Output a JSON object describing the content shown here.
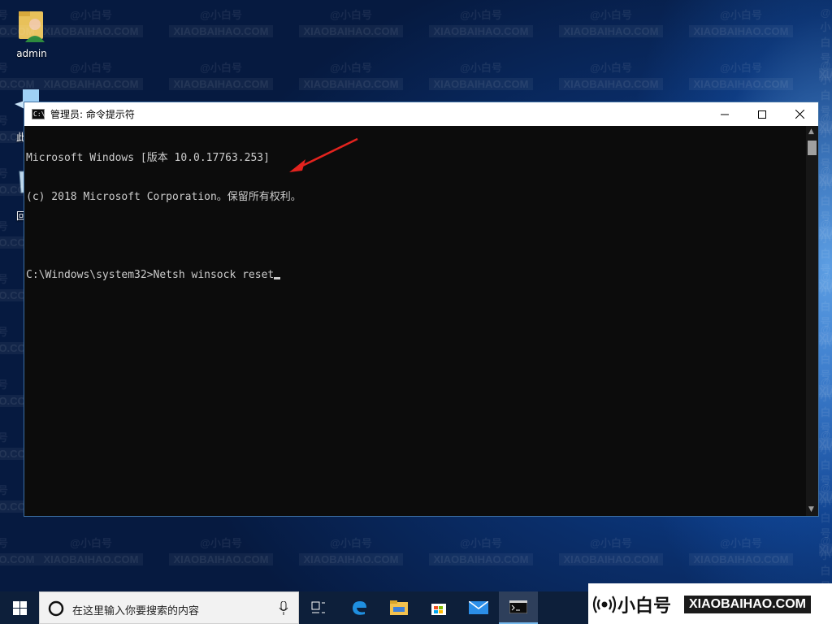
{
  "desktop": {
    "icons": [
      {
        "label": "admin",
        "icon": "user-folder-icon"
      },
      {
        "label": "此",
        "icon": "this-pc-icon"
      },
      {
        "label": "回",
        "icon": "recycle-bin-icon"
      }
    ]
  },
  "window": {
    "title": "管理员: 命令提示符",
    "icon_text": "C:\\",
    "controls": {
      "minimize": "minimize-icon",
      "maximize": "maximize-icon",
      "close": "close-icon"
    }
  },
  "console": {
    "lines": [
      "Microsoft Windows [版本 10.0.17763.253]",
      "(c) 2018 Microsoft Corporation。保留所有权利。",
      "",
      "C:\\Windows\\system32>Netsh winsock reset"
    ]
  },
  "taskbar": {
    "search_placeholder": "在这里输入你要搜索的内容",
    "items": [
      "task-view-icon",
      "edge-icon",
      "file-explorer-icon",
      "store-icon",
      "mail-icon",
      "command-prompt-icon"
    ]
  },
  "watermark": {
    "cn": "@小白号",
    "en": "XIAOBAIHAO.COM"
  },
  "logo": {
    "cn": "小白号",
    "en": "XIAOBAIHAO.COM"
  },
  "colors": {
    "console_bg": "#0c0c0c",
    "console_text": "#cccccc",
    "annotation_arrow": "#e3231e",
    "taskbar_bg": "#0d1f3a"
  }
}
